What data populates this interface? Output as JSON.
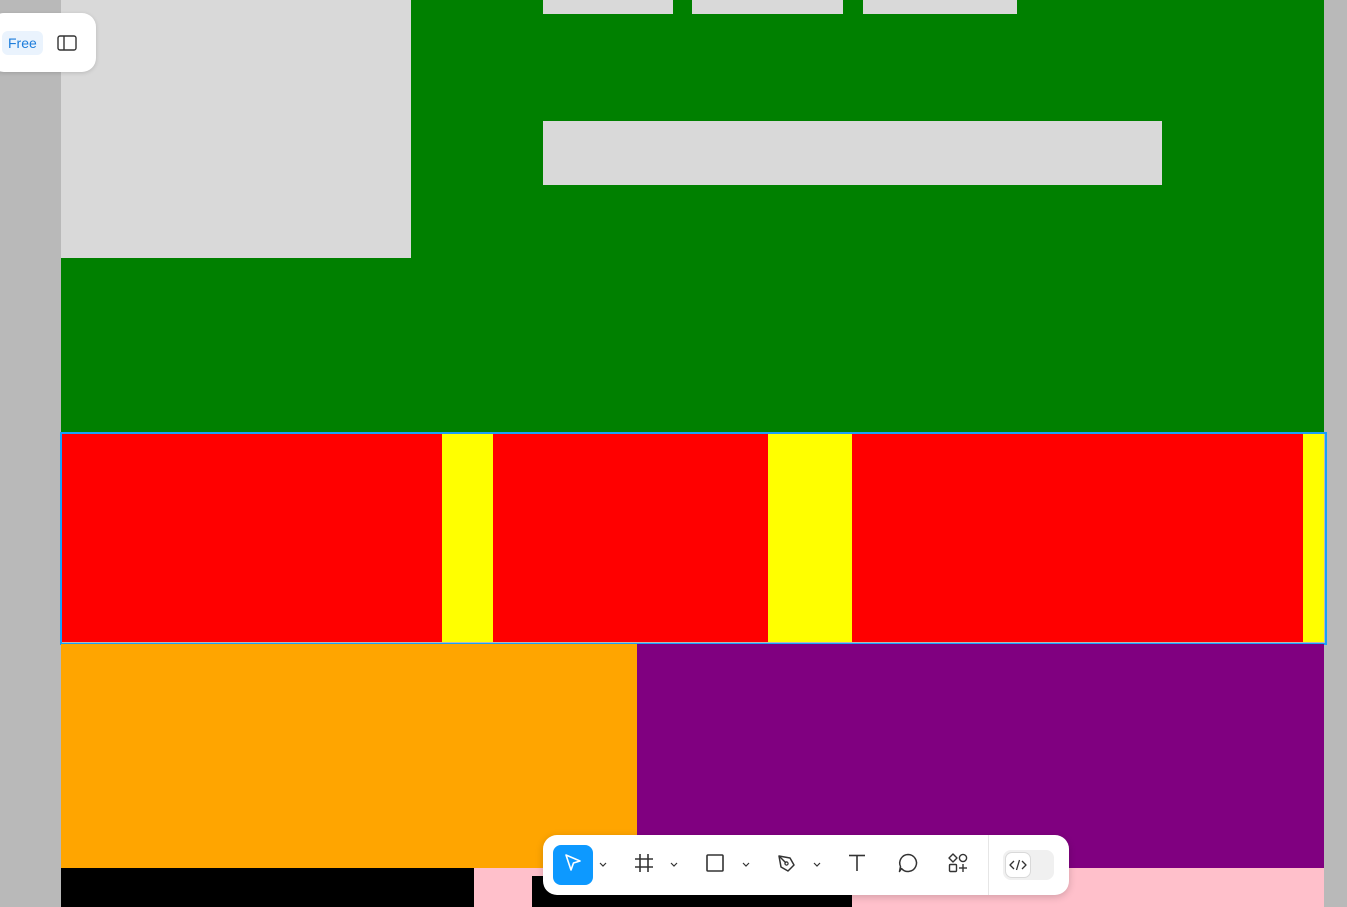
{
  "top_bar": {
    "plan_badge": "Free",
    "panel_toggle_icon": "sidebar-panel-icon"
  },
  "colors": {
    "canvas_bg": "#b9b9b9",
    "frame_green": "#008000",
    "placeholder_grey": "#d9d9d9",
    "selection_blue": "#18a0fb",
    "red": "#ff0000",
    "yellow": "#ffff00",
    "orange": "#ffa500",
    "purple": "#800080",
    "black": "#000000",
    "pink": "#ffc0cb",
    "tool_active": "#0d99ff"
  },
  "toolbar": {
    "tools": [
      {
        "name": "move-tool",
        "icon": "cursor-arrow-icon",
        "active": true,
        "has_menu": true
      },
      {
        "name": "frame-tool",
        "icon": "frame-hash-icon",
        "active": false,
        "has_menu": true
      },
      {
        "name": "shape-tool",
        "icon": "rectangle-icon",
        "active": false,
        "has_menu": true
      },
      {
        "name": "pen-tool",
        "icon": "pen-nib-icon",
        "active": false,
        "has_menu": true
      },
      {
        "name": "text-tool",
        "icon": "text-t-icon",
        "active": false,
        "has_menu": false
      },
      {
        "name": "comment-tool",
        "icon": "speech-bubble-icon",
        "active": false,
        "has_menu": false
      },
      {
        "name": "actions-tool",
        "icon": "shapes-plus-icon",
        "active": false,
        "has_menu": false
      }
    ],
    "dev_mode_icon": "code-brackets-icon"
  }
}
